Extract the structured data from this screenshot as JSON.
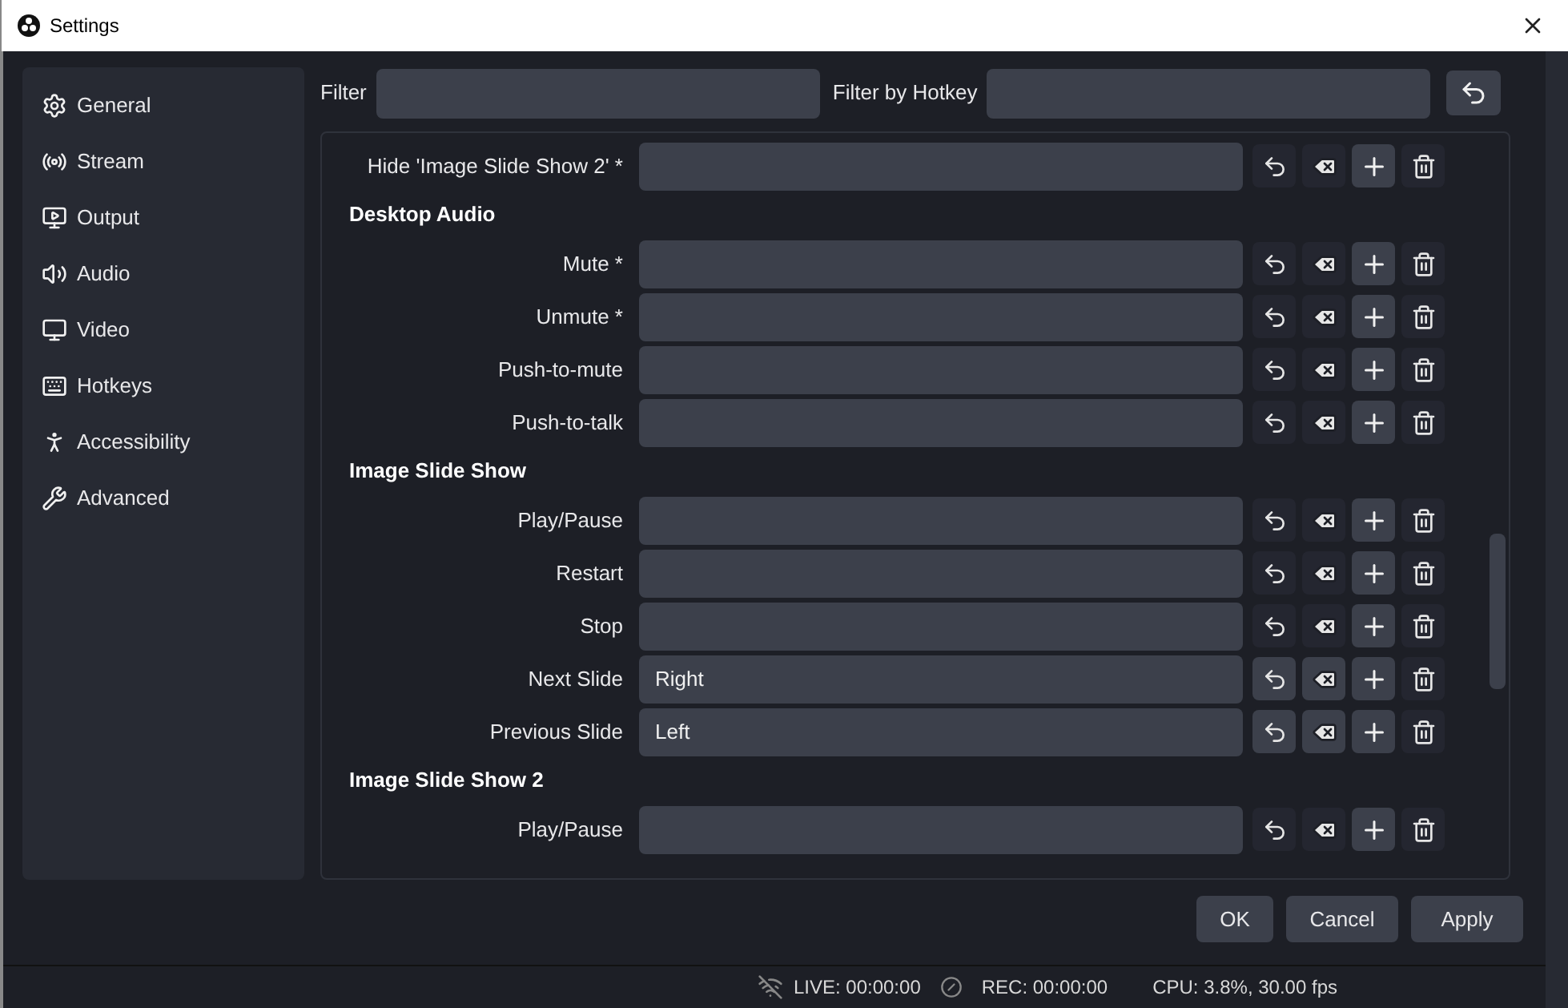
{
  "window": {
    "title": "Settings"
  },
  "sidebar": {
    "items": [
      {
        "label": "General"
      },
      {
        "label": "Stream"
      },
      {
        "label": "Output"
      },
      {
        "label": "Audio"
      },
      {
        "label": "Video"
      },
      {
        "label": "Hotkeys"
      },
      {
        "label": "Accessibility"
      },
      {
        "label": "Advanced"
      }
    ]
  },
  "filters": [
    {
      "label": "Filter"
    },
    {
      "label": "Filter by Hotkey"
    }
  ],
  "hotkeys": [
    {
      "kind": "row",
      "label": "Hide 'Image Slide Show 2' *"
    },
    {
      "kind": "header",
      "label": "Desktop Audio"
    },
    {
      "kind": "row",
      "label": "Mute *"
    },
    {
      "kind": "row",
      "label": "Unmute *"
    },
    {
      "kind": "row",
      "label": "Push-to-mute"
    },
    {
      "kind": "row",
      "label": "Push-to-talk"
    },
    {
      "kind": "header",
      "label": "Image Slide Show"
    },
    {
      "kind": "row",
      "label": "Play/Pause"
    },
    {
      "kind": "row",
      "label": "Restart"
    },
    {
      "kind": "row",
      "label": "Stop"
    },
    {
      "kind": "row",
      "label": "Next Slide",
      "value": "Right"
    },
    {
      "kind": "row",
      "label": "Previous Slide",
      "value": "Left"
    },
    {
      "kind": "header",
      "label": "Image Slide Show 2"
    },
    {
      "kind": "row",
      "label": "Play/Pause"
    }
  ],
  "buttons": [
    "OK",
    "Cancel",
    "Apply"
  ],
  "status_bar": {
    "live": "LIVE: 00:00:00",
    "rec": "REC: 00:00:00",
    "cpu": "CPU: 3.8%, 30.00 fps"
  }
}
